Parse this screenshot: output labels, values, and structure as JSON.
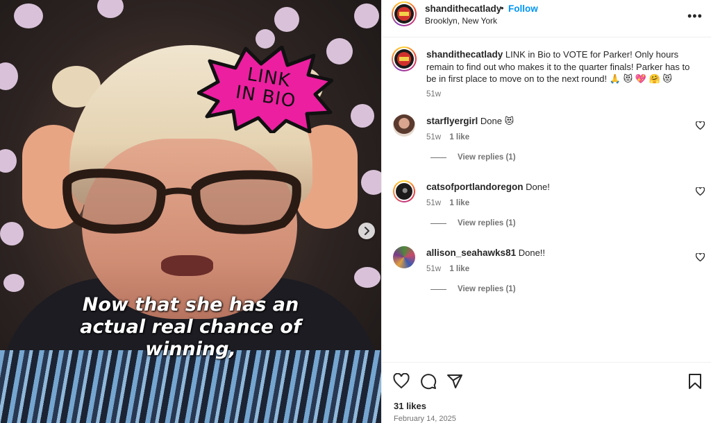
{
  "media": {
    "sticker_text_line1": "LINK",
    "sticker_text_line2": "IN BIO",
    "caption_line1": "Now that she has an",
    "caption_line2": "actual real chance of",
    "caption_line3": "winning,",
    "next_icon": "chevron-right-icon"
  },
  "header": {
    "username": "shandithecatlady",
    "separator": "•",
    "follow_label": "Follow",
    "location": "Brooklyn, New York",
    "more_icon": "more-horizontal-icon"
  },
  "caption": {
    "username": "shandithecatlady",
    "text": "LINK in Bio to VOTE for Parker! Only hours remain to find out who makes it to the quarter finals! Parker has to be in first place to move on to the next round! 🙏 😻 💖 🤗 😻",
    "time": "51w"
  },
  "comments": [
    {
      "username": "starflyergirl",
      "text": "Done 😻",
      "time": "51w",
      "likes": "1 like",
      "view_replies": "View replies (1)"
    },
    {
      "username": "catsofportlandoregon",
      "text": "Done!",
      "time": "51w",
      "likes": "1 like",
      "view_replies": "View replies (1)"
    },
    {
      "username": "allison_seahawks81",
      "text": "Done!!",
      "time": "51w",
      "likes": "1 like",
      "view_replies": "View replies (1)"
    }
  ],
  "footer": {
    "likes": "31 likes",
    "date": "February 14, 2025"
  },
  "colors": {
    "accent": "#0095f6",
    "sticker_pink": "#ec1fa0",
    "muted": "#737373"
  }
}
